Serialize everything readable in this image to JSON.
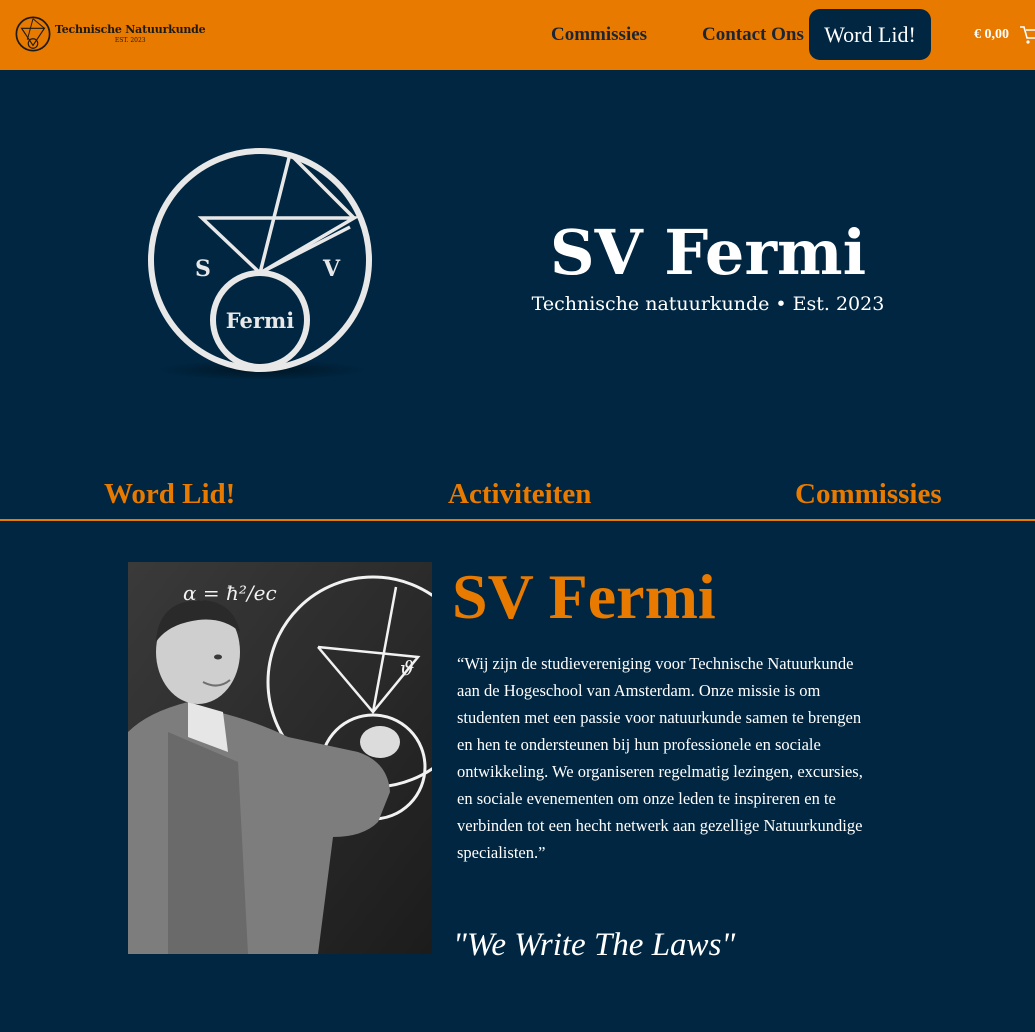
{
  "header": {
    "brand_name": "Technische Natuurkunde",
    "brand_est": "EST. 2023",
    "nav": [
      "Commissies",
      "Contact Ons"
    ],
    "join_button": "Word Lid!",
    "cart_total": "€ 0,00",
    "cart_icon": "cart-icon"
  },
  "hero": {
    "logo_letters": {
      "left": "S",
      "right": "V",
      "bottom": "Fermi"
    },
    "title": "SV Fermi",
    "subtitle": "Technische natuurkunde • Est. 2023"
  },
  "section_nav": [
    "Word Lid!",
    "Activiteiten",
    "Commissies"
  ],
  "content": {
    "title": "SV Fermi",
    "quote": "“Wij zijn de studievereniging voor Technische Natuurkunde aan de Hogeschool van Amsterdam. Onze missie is om studenten met een passie voor natuurkunde samen te brengen en hen te ondersteunen bij hun professionele en sociale ontwikkeling. We organiseren regelmatig lezingen, excursies, en sociale evenementen om onze leden te inspireren en te verbinden tot een hecht netwerk aan gezellige Natuurkundige specialisten.”",
    "motto": "\"We Write The Laws\"",
    "photo_formula": "α = ħ²/ec"
  },
  "colors": {
    "accent": "#e87a00",
    "background": "#002641",
    "text": "#ffffff"
  }
}
